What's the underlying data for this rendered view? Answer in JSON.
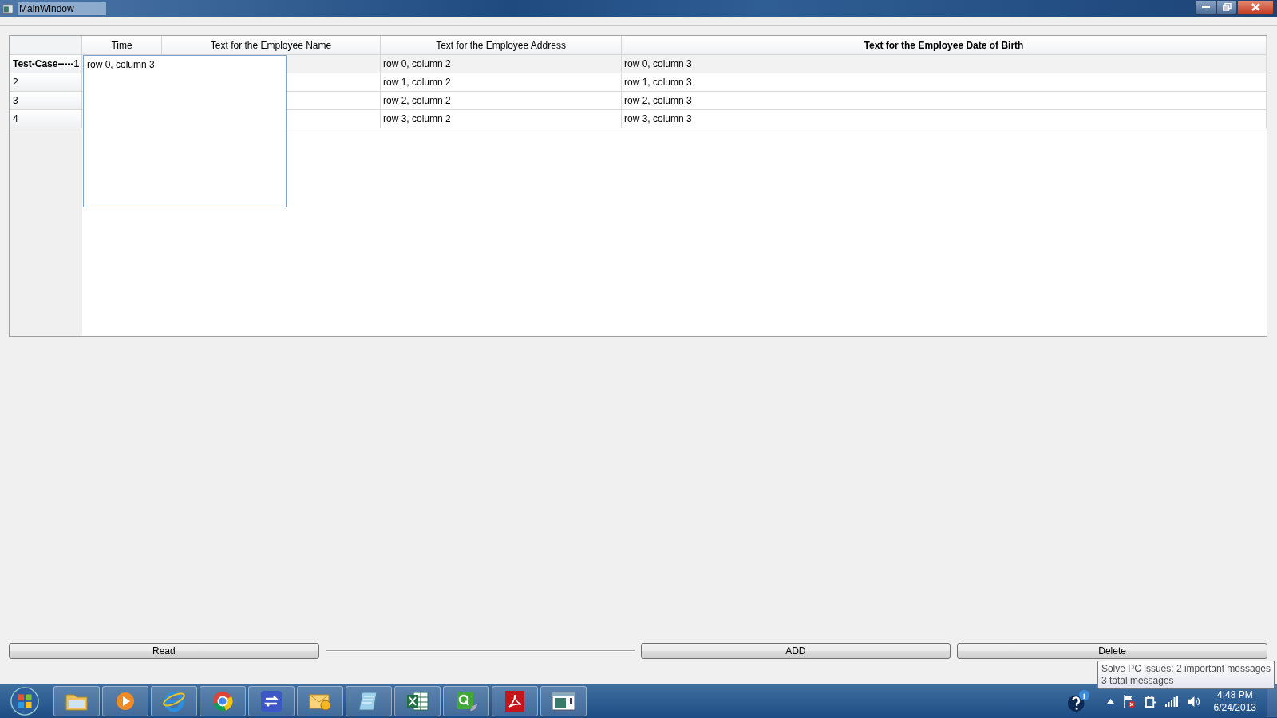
{
  "window": {
    "title": "MainWindow"
  },
  "table": {
    "columns": [
      {
        "label": "Time",
        "selected": false
      },
      {
        "label": "Text for the Employee Name",
        "selected": false
      },
      {
        "label": "Text for the Employee Address",
        "selected": false
      },
      {
        "label": "Text for the Employee Date of Birth",
        "selected": true
      }
    ],
    "rows": [
      {
        "header": "Test-Case-----1",
        "selected": true,
        "address": "row 0, column 2",
        "dob": "row 0, column 3"
      },
      {
        "header": "2",
        "selected": false,
        "address": "row 1, column 2",
        "dob": "row 1, column 3"
      },
      {
        "header": "3",
        "selected": false,
        "address": "row 2, column 2",
        "dob": "row 2, column 3"
      },
      {
        "header": "4",
        "selected": false,
        "address": "row 3, column 2",
        "dob": "row 3, column 3"
      }
    ],
    "editor": {
      "value": "row 0, column 3"
    }
  },
  "buttons": [
    "Read",
    "ADD",
    "Delete"
  ],
  "tooltip": {
    "lines": [
      "Solve PC issues: 2 important messages",
      "3 total messages"
    ]
  },
  "taskbar": {
    "items": [
      {
        "kind": "folder"
      },
      {
        "kind": "media"
      },
      {
        "kind": "browser-e"
      },
      {
        "kind": "browser-ring"
      },
      {
        "kind": "remote"
      },
      {
        "kind": "mail"
      },
      {
        "kind": "notepad"
      },
      {
        "kind": "sheet"
      },
      {
        "kind": "qt"
      },
      {
        "kind": "pdf"
      },
      {
        "kind": "window"
      }
    ],
    "time": "4:48 PM",
    "date": "6/24/2013"
  }
}
